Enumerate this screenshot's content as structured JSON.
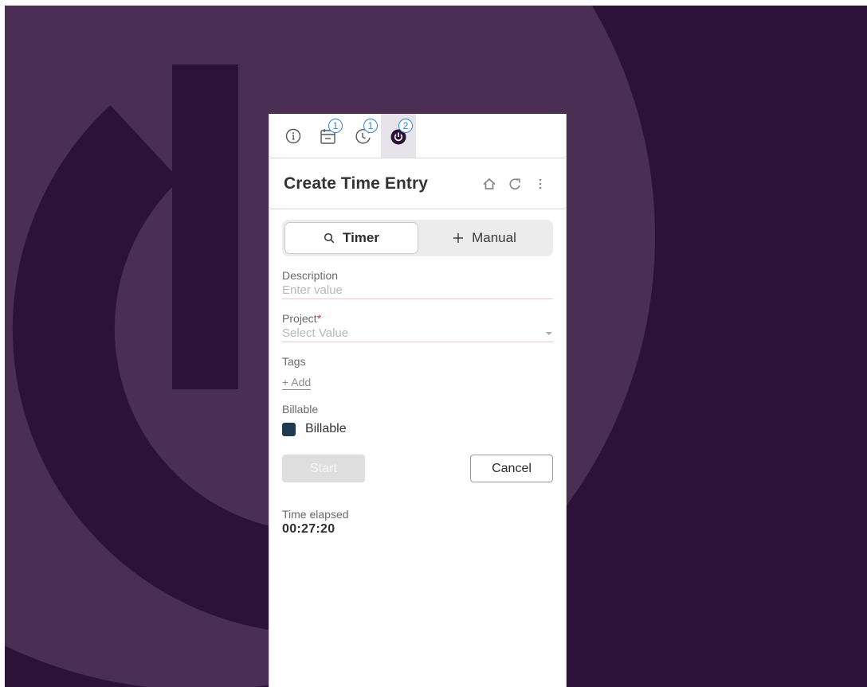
{
  "theme": {
    "background": "#2d1237",
    "art_light": "#4a2f52",
    "badge_color": "#2f86d6",
    "checkbox_color": "#1f3a52",
    "required_color": "#d0323b"
  },
  "tabs": [
    {
      "icon": "info-icon",
      "badge": ""
    },
    {
      "icon": "calendar-icon",
      "badge": "1"
    },
    {
      "icon": "clock-icon",
      "badge": "1"
    },
    {
      "icon": "power-icon",
      "badge": "2",
      "active": true
    }
  ],
  "header": {
    "title": "Create Time Entry",
    "icons": [
      "home-icon",
      "refresh-icon",
      "more-icon"
    ]
  },
  "mode": {
    "timer_label": "Timer",
    "manual_label": "Manual",
    "selected": "Timer"
  },
  "form": {
    "description": {
      "label": "Description",
      "placeholder": "Enter value",
      "value": ""
    },
    "project": {
      "label": "Project",
      "required_mark": "*",
      "placeholder": "Select Value"
    },
    "tags": {
      "label": "Tags",
      "add_label": "+ Add"
    },
    "billable": {
      "label": "Billable",
      "checkbox_label": "Billable",
      "checked": true
    }
  },
  "actions": {
    "start_label": "Start",
    "cancel_label": "Cancel"
  },
  "timer": {
    "label": "Time elapsed",
    "value": "00:27:20"
  }
}
